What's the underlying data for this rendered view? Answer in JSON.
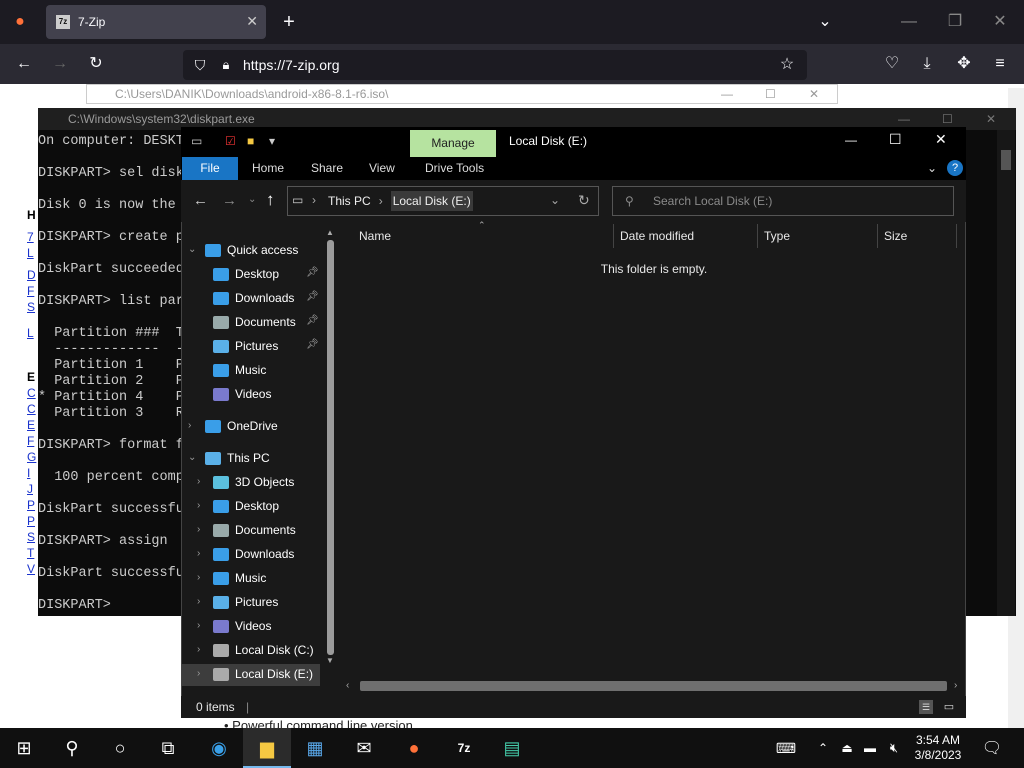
{
  "firefox": {
    "tab_title": "7-Zip",
    "tab_favicon": "7z",
    "url": "https://7-zip.org",
    "new_tab": "+",
    "close_tab": "✕"
  },
  "page": {
    "left_letters": [
      "H",
      "7",
      "L",
      "D",
      "F",
      "S",
      "L",
      "E",
      "C",
      "C",
      "E",
      "F",
      "G",
      "I",
      "J",
      "P",
      "P",
      "S",
      "T",
      "V"
    ],
    "bottom_text": "• Powerful command line version"
  },
  "background_window": {
    "path": "C:\\Users\\DANIK\\Downloads\\android-x86-8.1-r6.iso\\"
  },
  "cmd": {
    "title": "C:\\Windows\\system32\\diskpart.exe",
    "lines": [
      "On computer: DESKT",
      "",
      "DISKPART> sel disk",
      "",
      "Disk 0 is now the",
      "",
      "DISKPART> create p",
      "",
      "DiskPart succeeded",
      "",
      "DISKPART> list par",
      "",
      "  Partition ###  T",
      "  -------------  -",
      "  Partition 1    P",
      "  Partition 2    P",
      "* Partition 4    P",
      "  Partition 3    R",
      "",
      "DISKPART> format f",
      "",
      "  100 percent comp",
      "",
      "DiskPart successfu",
      "",
      "DISKPART> assign",
      "",
      "DiskPart successfu",
      "",
      "DISKPART>"
    ]
  },
  "explorer": {
    "title": "Local Disk (E:)",
    "manage_label": "Manage",
    "ribbon_tabs": {
      "file": "File",
      "home": "Home",
      "share": "Share",
      "view": "View",
      "drive_tools": "Drive Tools"
    },
    "address": {
      "this_pc": "This PC",
      "current": "Local Disk (E:)"
    },
    "search_placeholder": "Search Local Disk (E:)",
    "columns": {
      "name": "Name",
      "date_modified": "Date modified",
      "type": "Type",
      "size": "Size"
    },
    "empty_message": "This folder is empty.",
    "status": "0 items",
    "nav": {
      "quick_access": "Quick access",
      "quick_items": [
        "Desktop",
        "Downloads",
        "Documents",
        "Pictures",
        "Music",
        "Videos"
      ],
      "onedrive": "OneDrive",
      "this_pc": "This PC",
      "pc_items": [
        "3D Objects",
        "Desktop",
        "Documents",
        "Downloads",
        "Music",
        "Pictures",
        "Videos",
        "Local Disk (C:)",
        "Local Disk (E:)"
      ]
    }
  },
  "taskbar": {
    "time": "3:54 AM",
    "date": "3/8/2023"
  },
  "colors": {
    "accent": "#1975c5",
    "manage_green": "#b6e3a0",
    "selection": "#3d3d3d"
  }
}
